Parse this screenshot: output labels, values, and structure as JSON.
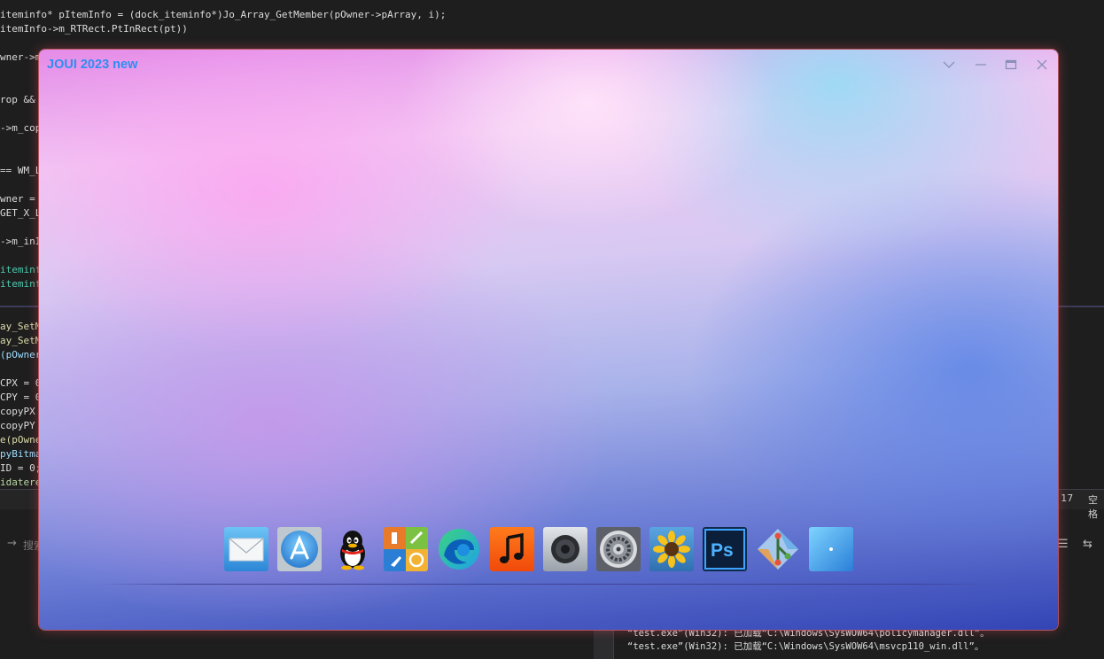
{
  "window": {
    "title": "JOUI 2023 new"
  },
  "dock": {
    "items": [
      {
        "name": "mail-app-icon"
      },
      {
        "name": "app-store-icon"
      },
      {
        "name": "qq-penguin-icon"
      },
      {
        "name": "launcher-tiles-icon"
      },
      {
        "name": "edge-browser-icon"
      },
      {
        "name": "music-icon"
      },
      {
        "name": "speaker-icon"
      },
      {
        "name": "system-settings-icon"
      },
      {
        "name": "sunflower-photos-icon"
      },
      {
        "name": "photoshop-icon"
      },
      {
        "name": "git-icon"
      },
      {
        "name": "safari-compass-icon"
      }
    ]
  },
  "ide": {
    "code_lines": [
      {
        "text": "iteminfo* pItemInfo = (dock_iteminfo*)Jo_Array_GetMember(pOwner->pArray, i);"
      },
      {
        "text": "itemInfo->m_RTRect.PtInRect(pt))"
      },
      {
        "text": "wner->m"
      },
      {
        "text": "rop &&"
      },
      {
        "text": "->m_cop"
      },
      {
        "text": "== WM_L"
      },
      {
        "text": "wner ="
      },
      {
        "text": "GET_X_L"
      },
      {
        "text": "->m_inI"
      },
      {
        "text": "iteminfo"
      },
      {
        "text": "iteminfo"
      },
      {
        "text": "ay_SetM"
      },
      {
        "text": "ay_SetM"
      },
      {
        "text": "(pOwner"
      },
      {
        "text": "CPX = 0"
      },
      {
        "text": "CPY = 0"
      },
      {
        "text": "copyPX"
      },
      {
        "text": "copyPY"
      },
      {
        "text": "e(pOwne"
      },
      {
        "text": "pyBitma"
      },
      {
        "text": "ID = 0;"
      },
      {
        "text": "idatere"
      }
    ],
    "status_col": ": 17",
    "status_space": "空格",
    "search_label": "搜索",
    "output_lines": [
      {
        "text": "“test.exe”(Win32): 已加载“C:\\Windows\\SysWOW64\\policymanager.dll”。"
      },
      {
        "text": "“test.exe”(Win32): 已加载“C:\\Windows\\SysWOW64\\msvcp110_win.dll”。"
      }
    ]
  }
}
